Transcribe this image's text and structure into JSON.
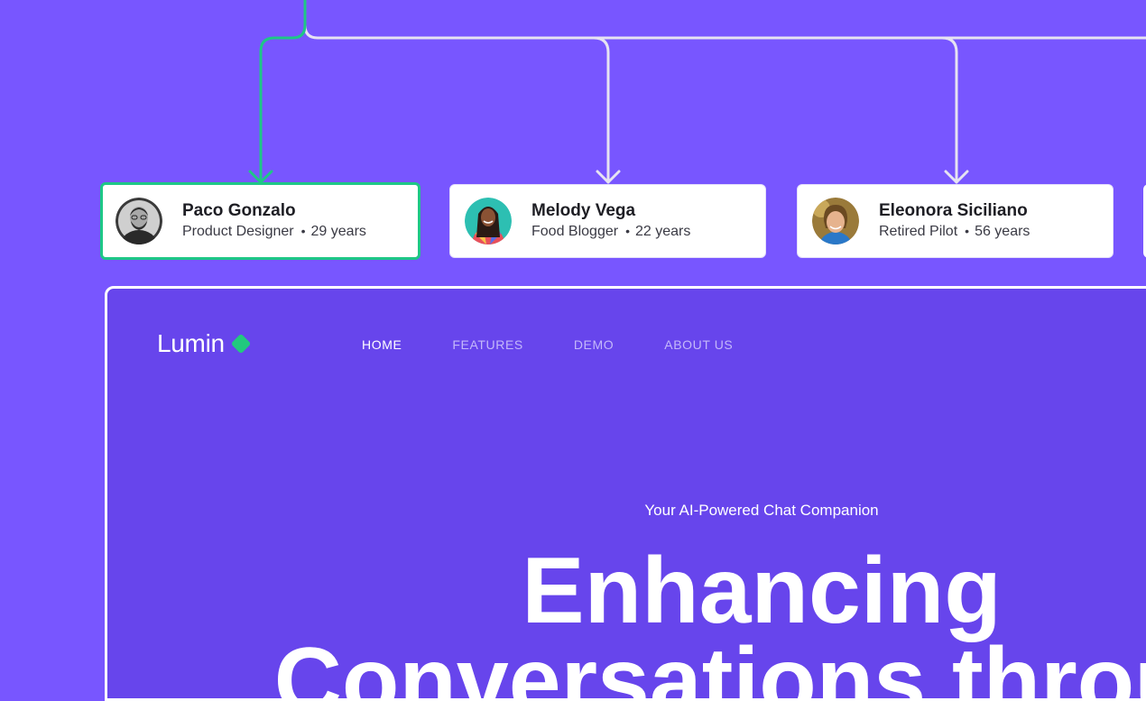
{
  "colors": {
    "background": "#7856FF",
    "frame_background": "#6745EC",
    "selected_border": "#1EC786",
    "connector_selected": "#1EC786",
    "connector_default": "#E6E3F2",
    "logo_accent": "#22C97E"
  },
  "personas": [
    {
      "name": "Paco Gonzalo",
      "role": "Product Designer",
      "age": "29 years",
      "selected": true,
      "avatar": "avatar-paco"
    },
    {
      "name": "Melody Vega",
      "role": "Food Blogger",
      "age": "22 years",
      "selected": false,
      "avatar": "avatar-melody"
    },
    {
      "name": "Eleonora Siciliano",
      "role": "Retired Pilot",
      "age": "56 years",
      "selected": false,
      "avatar": "avatar-eleonora"
    }
  ],
  "site": {
    "logo": "Lumin",
    "nav": [
      {
        "label": "HOME",
        "active": true
      },
      {
        "label": "FEATURES",
        "active": false
      },
      {
        "label": "DEMO",
        "active": false
      },
      {
        "label": "ABOUT US",
        "active": false
      }
    ],
    "tagline": "Your AI-Powered Chat Companion",
    "hero_line1": "Enhancing",
    "hero_line2": "Conversations throug"
  }
}
